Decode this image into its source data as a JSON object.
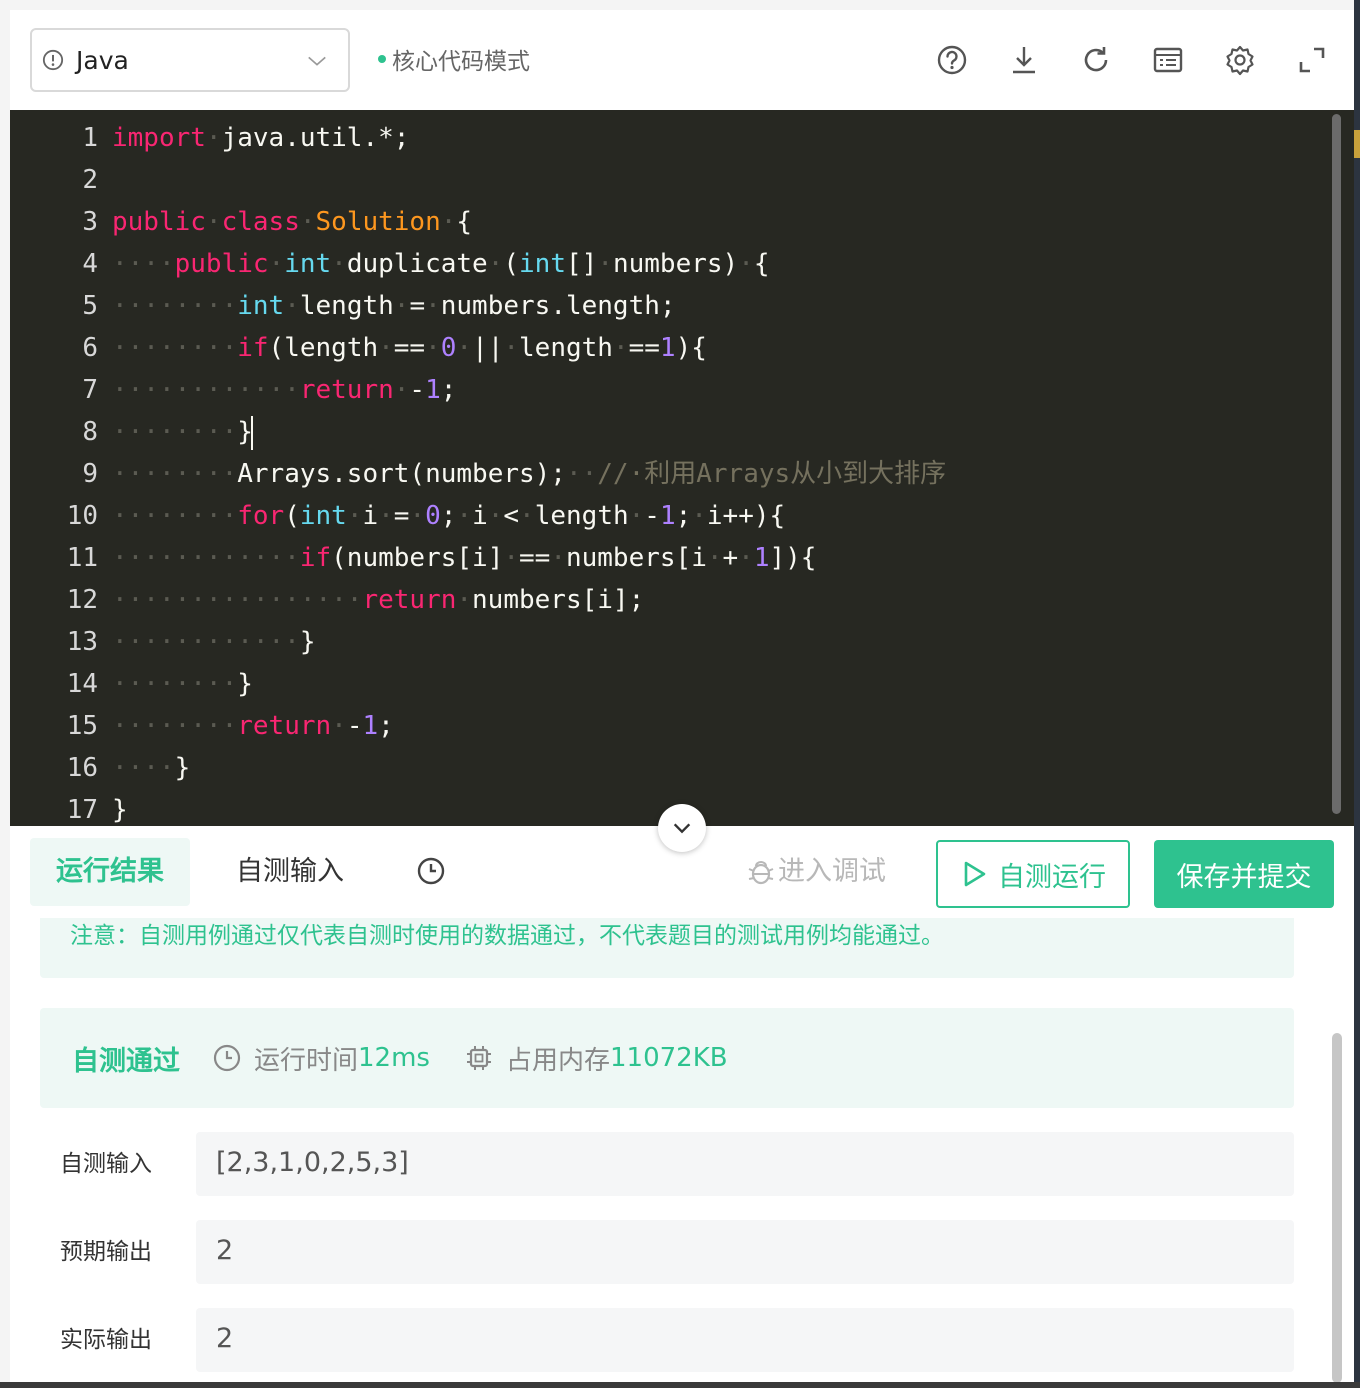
{
  "toolbar": {
    "language": "Java",
    "mode_label": "核心代码模式",
    "icons": [
      "help-icon",
      "download-icon",
      "refresh-icon",
      "keyboard-icon",
      "settings-icon",
      "fullscreen-icon"
    ]
  },
  "editor": {
    "lines": [
      {
        "n": "1",
        "tokens": [
          {
            "t": "import",
            "c": "kw"
          },
          {
            "t": "·",
            "c": "ws"
          },
          {
            "t": "java.util.*;"
          }
        ]
      },
      {
        "n": "2",
        "tokens": []
      },
      {
        "n": "3",
        "tokens": [
          {
            "t": "public",
            "c": "kw"
          },
          {
            "t": "·",
            "c": "ws"
          },
          {
            "t": "class",
            "c": "kw"
          },
          {
            "t": "·",
            "c": "ws"
          },
          {
            "t": "Solution",
            "c": "cls"
          },
          {
            "t": "·",
            "c": "ws"
          },
          {
            "t": "{"
          }
        ]
      },
      {
        "n": "4",
        "tokens": [
          {
            "t": "····",
            "c": "ws"
          },
          {
            "t": "public",
            "c": "kw"
          },
          {
            "t": "·",
            "c": "ws"
          },
          {
            "t": "int",
            "c": "ty"
          },
          {
            "t": "·",
            "c": "ws"
          },
          {
            "t": "duplicate"
          },
          {
            "t": "·",
            "c": "ws"
          },
          {
            "t": "("
          },
          {
            "t": "int",
            "c": "ty"
          },
          {
            "t": "[]"
          },
          {
            "t": "·",
            "c": "ws"
          },
          {
            "t": "numbers)"
          },
          {
            "t": "·",
            "c": "ws"
          },
          {
            "t": "{"
          }
        ]
      },
      {
        "n": "5",
        "tokens": [
          {
            "t": "········",
            "c": "ws"
          },
          {
            "t": "int",
            "c": "ty"
          },
          {
            "t": "·",
            "c": "ws"
          },
          {
            "t": "length"
          },
          {
            "t": "·",
            "c": "ws"
          },
          {
            "t": "="
          },
          {
            "t": "·",
            "c": "ws"
          },
          {
            "t": "numbers.length;"
          }
        ]
      },
      {
        "n": "6",
        "tokens": [
          {
            "t": "········",
            "c": "ws"
          },
          {
            "t": "if",
            "c": "kw"
          },
          {
            "t": "(length"
          },
          {
            "t": "·",
            "c": "ws"
          },
          {
            "t": "=="
          },
          {
            "t": "·",
            "c": "ws"
          },
          {
            "t": "0",
            "c": "num"
          },
          {
            "t": "·",
            "c": "ws"
          },
          {
            "t": "||"
          },
          {
            "t": "·",
            "c": "ws"
          },
          {
            "t": "length"
          },
          {
            "t": "·",
            "c": "ws"
          },
          {
            "t": "=="
          },
          {
            "t": "1",
            "c": "num"
          },
          {
            "t": "){"
          }
        ]
      },
      {
        "n": "7",
        "tokens": [
          {
            "t": "············",
            "c": "ws"
          },
          {
            "t": "return",
            "c": "kw"
          },
          {
            "t": "·",
            "c": "ws"
          },
          {
            "t": "-"
          },
          {
            "t": "1",
            "c": "num"
          },
          {
            "t": ";"
          }
        ]
      },
      {
        "n": "8",
        "tokens": [
          {
            "t": "········",
            "c": "ws"
          },
          {
            "t": "}"
          },
          {
            "t": "",
            "c": "cursor"
          }
        ]
      },
      {
        "n": "9",
        "tokens": [
          {
            "t": "········",
            "c": "ws"
          },
          {
            "t": "Arrays.sort(numbers);"
          },
          {
            "t": "··",
            "c": "ws"
          },
          {
            "t": "//·利用Arrays从小到大排序",
            "c": "cm"
          }
        ]
      },
      {
        "n": "10",
        "tokens": [
          {
            "t": "········",
            "c": "ws"
          },
          {
            "t": "for",
            "c": "kw"
          },
          {
            "t": "("
          },
          {
            "t": "int",
            "c": "ty"
          },
          {
            "t": "·",
            "c": "ws"
          },
          {
            "t": "i"
          },
          {
            "t": "·",
            "c": "ws"
          },
          {
            "t": "="
          },
          {
            "t": "·",
            "c": "ws"
          },
          {
            "t": "0",
            "c": "num"
          },
          {
            "t": ";"
          },
          {
            "t": "·",
            "c": "ws"
          },
          {
            "t": "i"
          },
          {
            "t": "·",
            "c": "ws"
          },
          {
            "t": "<"
          },
          {
            "t": "·",
            "c": "ws"
          },
          {
            "t": "length"
          },
          {
            "t": "·",
            "c": "ws"
          },
          {
            "t": "-"
          },
          {
            "t": "1",
            "c": "num"
          },
          {
            "t": ";"
          },
          {
            "t": "·",
            "c": "ws"
          },
          {
            "t": "i++){"
          }
        ]
      },
      {
        "n": "11",
        "tokens": [
          {
            "t": "············",
            "c": "ws"
          },
          {
            "t": "if",
            "c": "kw"
          },
          {
            "t": "(numbers[i]"
          },
          {
            "t": "·",
            "c": "ws"
          },
          {
            "t": "=="
          },
          {
            "t": "·",
            "c": "ws"
          },
          {
            "t": "numbers[i"
          },
          {
            "t": "·",
            "c": "ws"
          },
          {
            "t": "+"
          },
          {
            "t": "·",
            "c": "ws"
          },
          {
            "t": "1",
            "c": "num"
          },
          {
            "t": "]){"
          }
        ]
      },
      {
        "n": "12",
        "tokens": [
          {
            "t": "················",
            "c": "ws"
          },
          {
            "t": "return",
            "c": "kw"
          },
          {
            "t": "·",
            "c": "ws"
          },
          {
            "t": "numbers[i];"
          }
        ]
      },
      {
        "n": "13",
        "tokens": [
          {
            "t": "············",
            "c": "ws"
          },
          {
            "t": "}"
          }
        ]
      },
      {
        "n": "14",
        "tokens": [
          {
            "t": "········",
            "c": "ws"
          },
          {
            "t": "}"
          }
        ]
      },
      {
        "n": "15",
        "tokens": [
          {
            "t": "········",
            "c": "ws"
          },
          {
            "t": "return",
            "c": "kw"
          },
          {
            "t": "·",
            "c": "ws"
          },
          {
            "t": "-"
          },
          {
            "t": "1",
            "c": "num"
          },
          {
            "t": ";"
          }
        ]
      },
      {
        "n": "16",
        "tokens": [
          {
            "t": "····",
            "c": "ws"
          },
          {
            "t": "}"
          }
        ]
      },
      {
        "n": "17",
        "tokens": [
          {
            "t": "}"
          }
        ]
      }
    ]
  },
  "tabs": {
    "result": "运行结果",
    "self_input": "自测输入",
    "debug": "进入调试",
    "run": "自测运行",
    "submit": "保存并提交"
  },
  "results": {
    "notice": "注意：自测用例通过仅代表自测时使用的数据通过，不代表题目的测试用例均能通过。",
    "status": "自测通过",
    "time_label": "运行时间",
    "time_value": "12ms",
    "mem_label": "占用内存",
    "mem_value": "11072KB",
    "input_label": "自测输入",
    "input_value": "[2,3,1,0,2,5,3]",
    "expected_label": "预期输出",
    "expected_value": "2",
    "actual_label": "实际输出",
    "actual_value": "2"
  },
  "colors": {
    "accent": "#2ec28f",
    "editor_bg": "#272822",
    "keyword": "#f92672",
    "type": "#66d9ef",
    "class": "#fd971f",
    "number": "#ae81ff",
    "comment": "#75715e"
  }
}
